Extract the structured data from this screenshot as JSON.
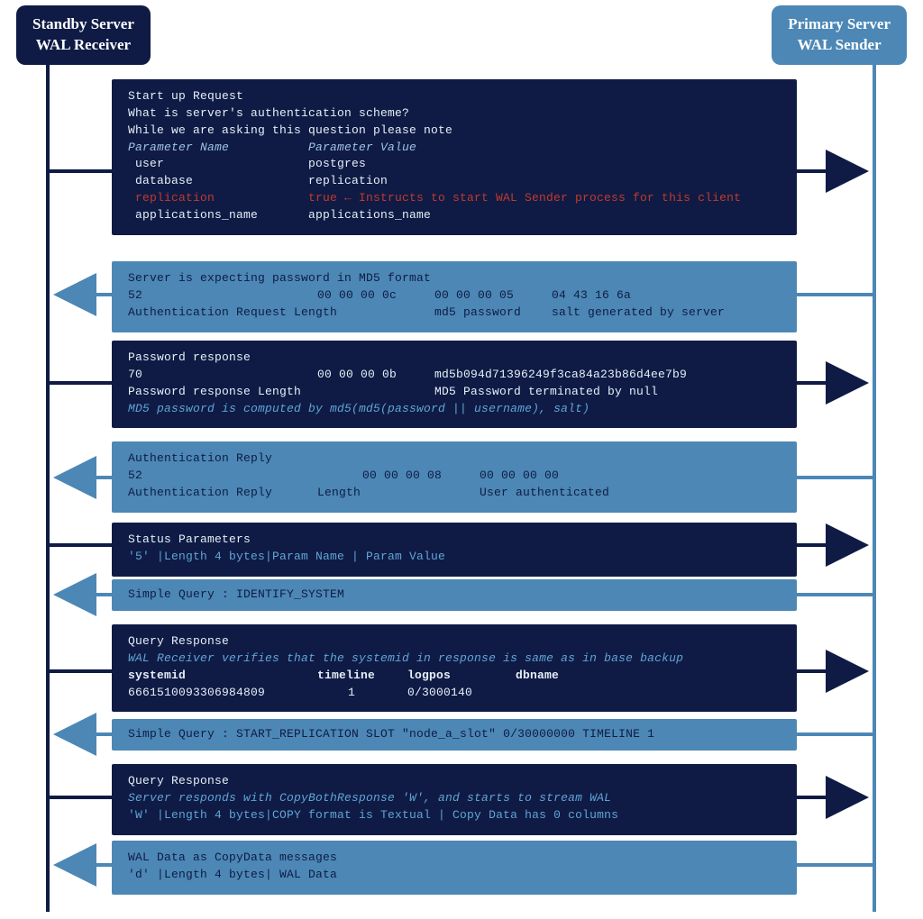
{
  "colors": {
    "dark_navy": "#0f1b45",
    "steel_blue": "#4c87b5",
    "red_accent": "#c23a2a"
  },
  "nodes": {
    "standby": {
      "line1": "Standby Server",
      "line2": "WAL Receiver"
    },
    "primary": {
      "line1": "Primary Server",
      "line2": "WAL Sender"
    }
  },
  "messages": [
    {
      "id": "startup",
      "title": "Start up Request",
      "line2": "What is server's authentication scheme?",
      "line3": "While we are asking this question please note",
      "param_name_hdr": "Parameter Name",
      "param_value_hdr": "Parameter Value",
      "params": [
        {
          "name": "user",
          "value": "postgres"
        },
        {
          "name": "database",
          "value": "replication"
        },
        {
          "name": "replication",
          "value": "true ← Instructs to start WAL Sender process for this client",
          "red": true
        },
        {
          "name": "applications_name",
          "value": "applications_name"
        }
      ]
    },
    {
      "id": "authreq",
      "title": "Server is expecting password in MD5 format",
      "row1": [
        "52",
        "00 00 00 0c",
        "00 00 00 05",
        "04 43 16 6a"
      ],
      "row2": [
        "Authentication Request Length",
        "",
        "md5 password",
        "salt generated by server"
      ]
    },
    {
      "id": "pwdresp",
      "title": "Password response",
      "row1": [
        "70",
        "00 00 00 0b",
        "md5b094d71396249f3ca84a23b86d4ee7b9"
      ],
      "row2": [
        "Password response Length",
        "",
        "MD5 Password terminated by null"
      ],
      "note": "MD5 password is computed by md5(md5(password || username), salt)"
    },
    {
      "id": "authreply",
      "title": "Authentication Reply",
      "row1": [
        "52",
        "00 00 00 08",
        "00 00 00 00"
      ],
      "row2": [
        "Authentication Reply",
        "Length",
        "User authenticated"
      ]
    },
    {
      "id": "status",
      "title": "Status Parameters",
      "detail": "'5' |Length 4 bytes|Param Name | Param Value"
    },
    {
      "id": "q_identify",
      "text": "Simple Query : IDENTIFY_SYSTEM"
    },
    {
      "id": "qresp_identify",
      "title": "Query Response",
      "note": "WAL Receiver verifies that the systemid in response is same as in base backup",
      "cols": [
        "systemid",
        "timeline",
        "logpos",
        "dbname"
      ],
      "vals": [
        "6661510093306984809",
        "1",
        "0/3000140",
        ""
      ]
    },
    {
      "id": "q_startrepl",
      "text": "Simple Query : START_REPLICATION SLOT \"node_a_slot\" 0/30000000 TIMELINE 1"
    },
    {
      "id": "qresp_copy",
      "title": "Query Response",
      "note": "Server responds with CopyBothResponse 'W', and starts to stream WAL",
      "detail": "'W' |Length 4 bytes|COPY format is Textual | Copy Data has 0 columns"
    },
    {
      "id": "waldata",
      "title": "WAL Data as CopyData messages",
      "detail": "'d' |Length 4 bytes| WAL Data"
    }
  ]
}
